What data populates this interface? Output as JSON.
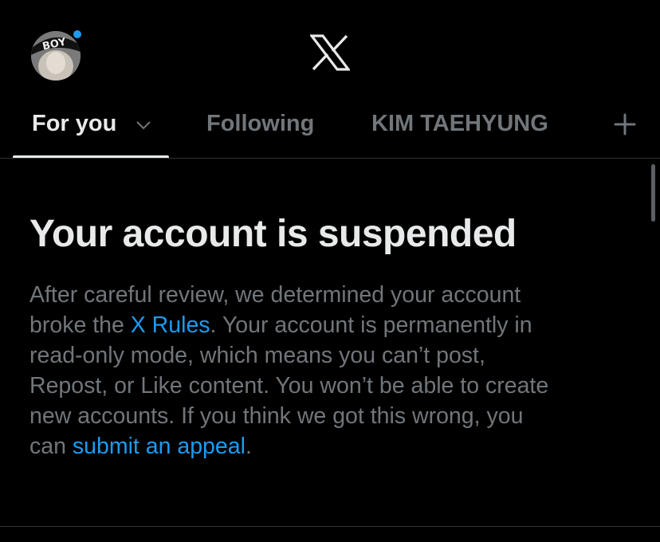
{
  "header": {
    "avatar_icon": "profile-avatar",
    "avatar_cap_text": "BOY",
    "logo_icon": "x-logo"
  },
  "tabs": [
    {
      "label": "For you",
      "active": true,
      "has_dropdown": true
    },
    {
      "label": "Following",
      "active": false
    },
    {
      "label": "KIM TAEHYUNG",
      "active": false
    }
  ],
  "add_tab_icon": "plus-icon",
  "notice": {
    "title": "Your account is suspended",
    "line1": "After careful review, we determined your account",
    "line2_pre": "broke the ",
    "rules_link": "X Rules",
    "line2_post": ". Your account is permanently in",
    "line3": "read-only mode, which means you can’t post,",
    "line4": "Repost, or Like content. You won’t be able to create",
    "line5": "new accounts. If you think we got this wrong, you",
    "line6_pre": "can ",
    "appeal_link": "submit an appeal",
    "line6_post": "."
  },
  "colors": {
    "background": "#000000",
    "primary_text": "#e7e9ea",
    "secondary_text": "#71767b",
    "link": "#1d9bf0",
    "divider": "#2f3336"
  }
}
